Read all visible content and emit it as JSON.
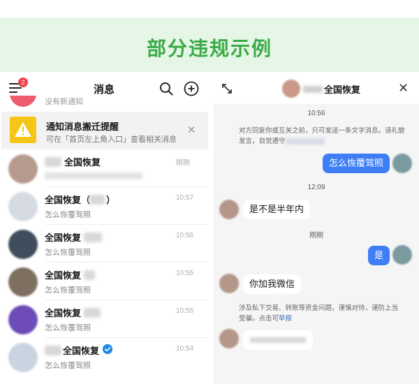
{
  "banner": {
    "title": "部分违规示例"
  },
  "left_panel": {
    "title": "消息",
    "badge_count": "2",
    "top_partial_text": "没有新通知",
    "notice": {
      "title": "通知消息搬迁提醒",
      "subtitle": "可在「首页左上角入口」查看相关消息",
      "close": "✕"
    },
    "conversations": [
      {
        "name": "全国恢复",
        "time": "刚刚",
        "preview": ""
      },
      {
        "name": "全国恢复（",
        "name_suffix": "）",
        "time": "10:57",
        "preview": "怎么恢覆驾照"
      },
      {
        "name": "全国恢复",
        "time": "10:56",
        "preview": "怎么恢覆驾照"
      },
      {
        "name": "全国恢复",
        "time": "10:55",
        "preview": "怎么恢覆驾照"
      },
      {
        "name": "全国恢复",
        "time": "10:55",
        "preview": "怎么恢覆驾照"
      },
      {
        "name": "全国恢复",
        "time": "10:54",
        "preview": "怎么恢覆驾照"
      }
    ]
  },
  "right_panel": {
    "title": "全国恢复",
    "close": "✕",
    "times": [
      "10:56",
      "12:09",
      "刚刚"
    ],
    "system_notice_1_line1": "对方回复你或互关之前，只可发送一条文字消息。请礼貌",
    "system_notice_1_line2": "发言，自觉遵守",
    "system_notice_2_line1": "涉及私下交易、转账等资金问题，谨慎对待，谨防上当",
    "system_notice_2_line2": "受骗，点击可",
    "report_link": "举报",
    "messages": [
      {
        "from": "me",
        "text": "怎么恢覆驾照"
      },
      {
        "from": "other",
        "text": "是不是半年内"
      },
      {
        "from": "me",
        "text": "是"
      },
      {
        "from": "other",
        "text": "你加我微信"
      }
    ]
  },
  "colors": {
    "banner_bg": "#e6f6e6",
    "banner_text": "#3aab47",
    "badge": "#f0424a",
    "outgoing_bubble": "#3d7df5",
    "verified": "#1e88e5",
    "warning_icon": "#f5c518"
  },
  "icons": [
    "menu-icon",
    "search-icon",
    "add-icon",
    "warning-icon",
    "close-icon",
    "expand-icon",
    "verified-icon"
  ]
}
